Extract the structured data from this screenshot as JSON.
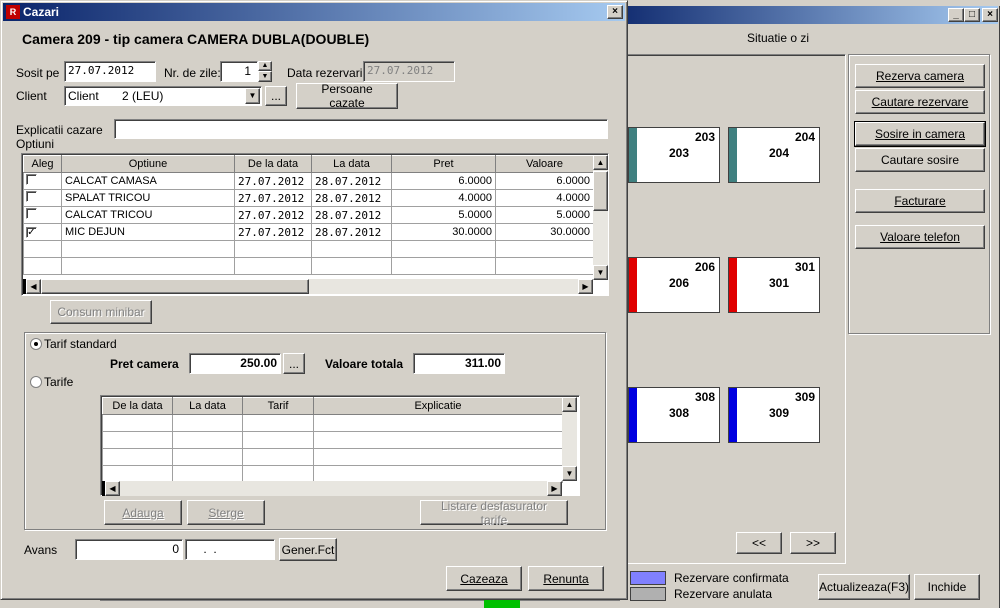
{
  "bg_window": {
    "header_label": "Situatie o zi",
    "buttons": {
      "rezerva_camera": "Rezerva camera",
      "cautare_rezervare": "Cautare rezervare",
      "sosire_in_camera": "Sosire in camera",
      "cautare_sosire": "Cautare sosire",
      "facturare": "Facturare",
      "valoare_telefon": "Valoare telefon",
      "prev": "<<",
      "next": ">>",
      "actualizeaza": "Actualizeaza(F3)",
      "inchide": "Inchide"
    },
    "rooms": [
      {
        "top": "203",
        "center": "203",
        "color": "#3f8080"
      },
      {
        "top": "204",
        "center": "204",
        "color": "#3f8080"
      },
      {
        "top": "206",
        "center": "206",
        "color": "#e00000"
      },
      {
        "top": "301",
        "center": "301",
        "color": "#e00000"
      },
      {
        "top": "308",
        "center": "308",
        "color": "#0000e0"
      },
      {
        "top": "309",
        "center": "309",
        "color": "#0000e0"
      }
    ],
    "legend": [
      {
        "label": "Rezervare confirmata",
        "color": "#8080ff"
      },
      {
        "label": "Rezervare anulata",
        "color": "#b0b0b0"
      }
    ]
  },
  "dialog": {
    "title": "Cazari",
    "heading": "Camera 209  - tip camera CAMERA DUBLA(DOUBLE)",
    "sosit_pe_label": "Sosit pe",
    "sosit_pe_value": "27.07.2012",
    "nr_zile_label": "Nr. de zile:",
    "nr_zile_value": "1",
    "data_rezervarii_label": "Data rezervarii",
    "data_rezervarii_value": "27.07.2012",
    "client_label": "Client",
    "client_value": "Client       2 (LEU)",
    "ellipsis": "...",
    "persoane_cazate": "Persoane cazate",
    "explicatii_label": "Explicatii cazare",
    "explicatii_value": "",
    "optiuni_label": "Optiuni",
    "options_columns": [
      "Aleg",
      "Optiune",
      "De la data",
      "La data",
      "Pret",
      "Valoare"
    ],
    "options_rows": [
      {
        "checked": false,
        "optiune": "CALCAT CAMASA",
        "de_la": "27.07.2012",
        "la": "28.07.2012",
        "pret": "6.0000",
        "valoare": "6.0000"
      },
      {
        "checked": false,
        "optiune": "SPALAT TRICOU",
        "de_la": "27.07.2012",
        "la": "28.07.2012",
        "pret": "4.0000",
        "valoare": "4.0000"
      },
      {
        "checked": false,
        "optiune": "CALCAT TRICOU",
        "de_la": "27.07.2012",
        "la": "28.07.2012",
        "pret": "5.0000",
        "valoare": "5.0000"
      },
      {
        "checked": true,
        "optiune": "MIC DEJUN",
        "de_la": "27.07.2012",
        "la": "28.07.2012",
        "pret": "30.0000",
        "valoare": "30.0000"
      }
    ],
    "consum_minibar": "Consum minibar",
    "tarif_standard_label": "Tarif standard",
    "tarife_label": "Tarife",
    "pret_camera_label": "Pret camera",
    "pret_camera_value": "250.00",
    "valoare_totala_label": "Valoare totala",
    "valoare_totala_value": "311.00",
    "tarife_columns": [
      "De la data",
      "La data",
      "Tarif",
      "Explicatie"
    ],
    "adauga": "Adauga",
    "sterge": "Sterge",
    "listare": "Listare desfasurator tarife",
    "avans_label": "Avans",
    "avans_value": "0",
    "avans_date": " .  .",
    "gener_fct": "Gener.Fct",
    "cazeaza": "Cazeaza",
    "renunta": "Renunta"
  }
}
